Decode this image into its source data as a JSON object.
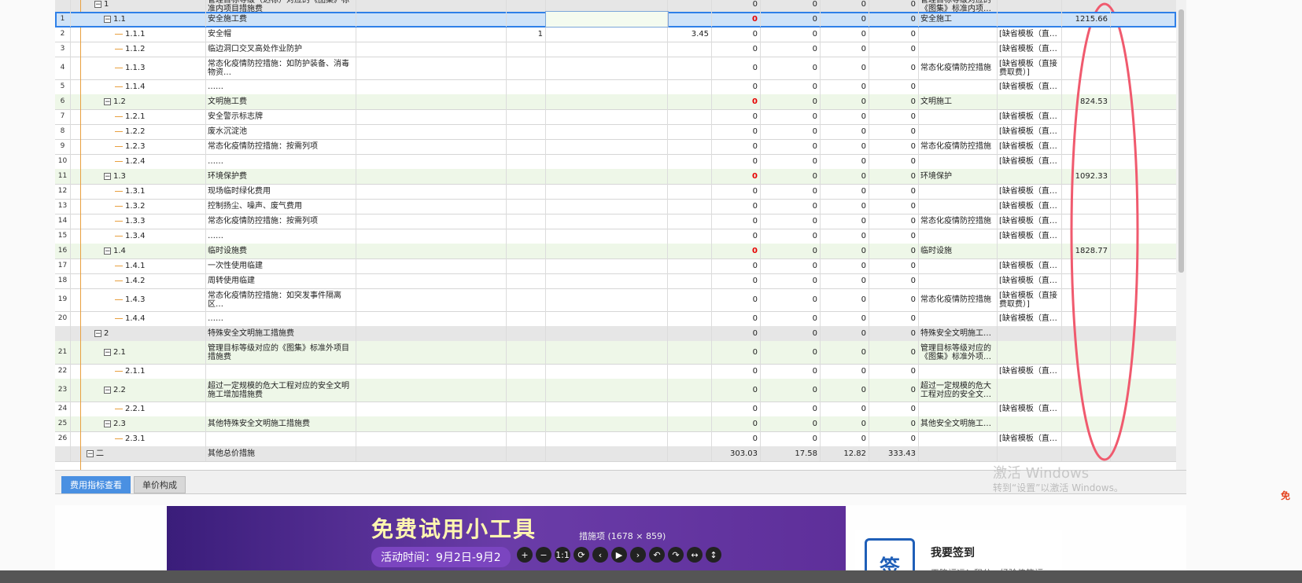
{
  "rows": [
    {
      "num": "",
      "code": "1",
      "depth": 1,
      "toggle": "−",
      "name": "管理目标等级（达标）对应的《图集》标准内项目措施费",
      "d1": "",
      "d2": "",
      "d4": "",
      "v1": "0",
      "v1red": false,
      "v2": "0",
      "v3": "0",
      "v4": "0",
      "cat": "管理目标等级对应的《图集》标准内项…",
      "tpl": "",
      "amt": "",
      "style": "gray",
      "h": 20
    },
    {
      "num": "1",
      "code": "1.1",
      "depth": 2,
      "toggle": "−",
      "name": "安全施工费",
      "d1": "",
      "d2": "",
      "d4": "",
      "v1": "0",
      "v1red": true,
      "v2": "0",
      "v3": "0",
      "v4": "0",
      "cat": "安全施工",
      "tpl": "",
      "amt": "1215.66",
      "style": "sel",
      "h": 20
    },
    {
      "num": "2",
      "code": "1.1.1",
      "depth": 3,
      "toggle": "",
      "name": "安全帽",
      "d1": "",
      "d2": "1",
      "d4": "3.45",
      "v1": "0",
      "v1red": false,
      "v2": "0",
      "v3": "0",
      "v4": "0",
      "cat": "",
      "tpl": "[缺省模板（直…",
      "amt": "",
      "style": "",
      "h": 20
    },
    {
      "num": "3",
      "code": "1.1.2",
      "depth": 3,
      "toggle": "",
      "name": "临边洞口交叉高处作业防护",
      "d1": "",
      "d2": "",
      "d4": "",
      "v1": "0",
      "v1red": false,
      "v2": "0",
      "v3": "0",
      "v4": "0",
      "cat": "",
      "tpl": "[缺省模板（直…",
      "amt": "",
      "style": "",
      "h": 20
    },
    {
      "num": "4",
      "code": "1.1.3",
      "depth": 3,
      "toggle": "",
      "name": "常态化疫情防控措施：如防护装备、消毒物资…",
      "d1": "",
      "d2": "",
      "d4": "",
      "v1": "0",
      "v1red": false,
      "v2": "0",
      "v3": "0",
      "v4": "0",
      "cat": "常态化疫情防控措施",
      "tpl": "[缺省模板（直接费取费）]",
      "amt": "",
      "style": "",
      "h": 30
    },
    {
      "num": "5",
      "code": "1.1.4",
      "depth": 3,
      "toggle": "",
      "name": "……",
      "d1": "",
      "d2": "",
      "d4": "",
      "v1": "0",
      "v1red": false,
      "v2": "0",
      "v3": "0",
      "v4": "0",
      "cat": "",
      "tpl": "[缺省模板（直…",
      "amt": "",
      "style": "",
      "h": 20
    },
    {
      "num": "6",
      "code": "1.2",
      "depth": 2,
      "toggle": "−",
      "name": "文明施工费",
      "d1": "",
      "d2": "",
      "d4": "",
      "v1": "0",
      "v1red": true,
      "v2": "0",
      "v3": "0",
      "v4": "0",
      "cat": "文明施工",
      "tpl": "",
      "amt": "824.53",
      "style": "g",
      "h": 20
    },
    {
      "num": "7",
      "code": "1.2.1",
      "depth": 3,
      "toggle": "",
      "name": "安全警示标志牌",
      "d1": "",
      "d2": "",
      "d4": "",
      "v1": "0",
      "v1red": false,
      "v2": "0",
      "v3": "0",
      "v4": "0",
      "cat": "",
      "tpl": "[缺省模板（直…",
      "amt": "",
      "style": "",
      "h": 20
    },
    {
      "num": "8",
      "code": "1.2.2",
      "depth": 3,
      "toggle": "",
      "name": "废水沉淀池",
      "d1": "",
      "d2": "",
      "d4": "",
      "v1": "0",
      "v1red": false,
      "v2": "0",
      "v3": "0",
      "v4": "0",
      "cat": "",
      "tpl": "[缺省模板（直…",
      "amt": "",
      "style": "",
      "h": 20
    },
    {
      "num": "9",
      "code": "1.2.3",
      "depth": 3,
      "toggle": "",
      "name": "常态化疫情防控措施：按需列项",
      "d1": "",
      "d2": "",
      "d4": "",
      "v1": "0",
      "v1red": false,
      "v2": "0",
      "v3": "0",
      "v4": "0",
      "cat": "常态化疫情防控措施",
      "tpl": "[缺省模板（直…",
      "amt": "",
      "style": "",
      "h": 20
    },
    {
      "num": "10",
      "code": "1.2.4",
      "depth": 3,
      "toggle": "",
      "name": "……",
      "d1": "",
      "d2": "",
      "d4": "",
      "v1": "0",
      "v1red": false,
      "v2": "0",
      "v3": "0",
      "v4": "0",
      "cat": "",
      "tpl": "[缺省模板（直…",
      "amt": "",
      "style": "",
      "h": 20
    },
    {
      "num": "11",
      "code": "1.3",
      "depth": 2,
      "toggle": "−",
      "name": "环境保护费",
      "d1": "",
      "d2": "",
      "d4": "",
      "v1": "0",
      "v1red": true,
      "v2": "0",
      "v3": "0",
      "v4": "0",
      "cat": "环境保护",
      "tpl": "",
      "amt": "1092.33",
      "style": "g",
      "h": 20
    },
    {
      "num": "12",
      "code": "1.3.1",
      "depth": 3,
      "toggle": "",
      "name": "现场临时绿化费用",
      "d1": "",
      "d2": "",
      "d4": "",
      "v1": "0",
      "v1red": false,
      "v2": "0",
      "v3": "0",
      "v4": "0",
      "cat": "",
      "tpl": "[缺省模板（直…",
      "amt": "",
      "style": "",
      "h": 20
    },
    {
      "num": "13",
      "code": "1.3.2",
      "depth": 3,
      "toggle": "",
      "name": "控制扬尘、噪声、废气费用",
      "d1": "",
      "d2": "",
      "d4": "",
      "v1": "0",
      "v1red": false,
      "v2": "0",
      "v3": "0",
      "v4": "0",
      "cat": "",
      "tpl": "[缺省模板（直…",
      "amt": "",
      "style": "",
      "h": 20
    },
    {
      "num": "14",
      "code": "1.3.3",
      "depth": 3,
      "toggle": "",
      "name": "常态化疫情防控措施：按需列项",
      "d1": "",
      "d2": "",
      "d4": "",
      "v1": "0",
      "v1red": false,
      "v2": "0",
      "v3": "0",
      "v4": "0",
      "cat": "常态化疫情防控措施",
      "tpl": "[缺省模板（直…",
      "amt": "",
      "style": "",
      "h": 20
    },
    {
      "num": "15",
      "code": "1.3.4",
      "depth": 3,
      "toggle": "",
      "name": "……",
      "d1": "",
      "d2": "",
      "d4": "",
      "v1": "0",
      "v1red": false,
      "v2": "0",
      "v3": "0",
      "v4": "0",
      "cat": "",
      "tpl": "[缺省模板（直…",
      "amt": "",
      "style": "",
      "h": 20
    },
    {
      "num": "16",
      "code": "1.4",
      "depth": 2,
      "toggle": "−",
      "name": "临时设施费",
      "d1": "",
      "d2": "",
      "d4": "",
      "v1": "0",
      "v1red": true,
      "v2": "0",
      "v3": "0",
      "v4": "0",
      "cat": "临时设施",
      "tpl": "",
      "amt": "1828.77",
      "style": "g",
      "h": 20
    },
    {
      "num": "17",
      "code": "1.4.1",
      "depth": 3,
      "toggle": "",
      "name": "一次性使用临建",
      "d1": "",
      "d2": "",
      "d4": "",
      "v1": "0",
      "v1red": false,
      "v2": "0",
      "v3": "0",
      "v4": "0",
      "cat": "",
      "tpl": "[缺省模板（直…",
      "amt": "",
      "style": "",
      "h": 20
    },
    {
      "num": "18",
      "code": "1.4.2",
      "depth": 3,
      "toggle": "",
      "name": "周转使用临建",
      "d1": "",
      "d2": "",
      "d4": "",
      "v1": "0",
      "v1red": false,
      "v2": "0",
      "v3": "0",
      "v4": "0",
      "cat": "",
      "tpl": "[缺省模板（直…",
      "amt": "",
      "style": "",
      "h": 20
    },
    {
      "num": "19",
      "code": "1.4.3",
      "depth": 3,
      "toggle": "",
      "name": "常态化疫情防控措施：如突发事件隔离区…",
      "d1": "",
      "d2": "",
      "d4": "",
      "v1": "0",
      "v1red": false,
      "v2": "0",
      "v3": "0",
      "v4": "0",
      "cat": "常态化疫情防控措施",
      "tpl": "[缺省模板（直接费取费）]",
      "amt": "",
      "style": "",
      "h": 30
    },
    {
      "num": "20",
      "code": "1.4.4",
      "depth": 3,
      "toggle": "",
      "name": "……",
      "d1": "",
      "d2": "",
      "d4": "",
      "v1": "0",
      "v1red": false,
      "v2": "0",
      "v3": "0",
      "v4": "0",
      "cat": "",
      "tpl": "[缺省模板（直…",
      "amt": "",
      "style": "",
      "h": 20
    },
    {
      "num": "",
      "code": "2",
      "depth": 1,
      "toggle": "−",
      "name": "特殊安全文明施工措施费",
      "d1": "",
      "d2": "",
      "d4": "",
      "v1": "0",
      "v1red": false,
      "v2": "0",
      "v3": "0",
      "v4": "0",
      "cat": "特殊安全文明施工…",
      "tpl": "",
      "amt": "",
      "style": "gray",
      "h": 20
    },
    {
      "num": "21",
      "code": "2.1",
      "depth": 2,
      "toggle": "−",
      "name": "管理目标等级对应的《图集》标准外项目措施费",
      "d1": "",
      "d2": "",
      "d4": "",
      "v1": "0",
      "v1red": false,
      "v2": "0",
      "v3": "0",
      "v4": "0",
      "cat": "管理目标等级对应的《图集》标准外项…",
      "tpl": "",
      "amt": "",
      "style": "g",
      "h": 30
    },
    {
      "num": "22",
      "code": "2.1.1",
      "depth": 3,
      "toggle": "",
      "name": "",
      "d1": "",
      "d2": "",
      "d4": "",
      "v1": "0",
      "v1red": false,
      "v2": "0",
      "v3": "0",
      "v4": "0",
      "cat": "",
      "tpl": "[缺省模板（直…",
      "amt": "",
      "style": "",
      "h": 20
    },
    {
      "num": "23",
      "code": "2.2",
      "depth": 2,
      "toggle": "−",
      "name": "超过一定规模的危大工程对应的安全文明施工增加措施费",
      "d1": "",
      "d2": "",
      "d4": "",
      "v1": "0",
      "v1red": false,
      "v2": "0",
      "v3": "0",
      "v4": "0",
      "cat": "超过一定规模的危大工程对应的安全文…",
      "tpl": "",
      "amt": "",
      "style": "g",
      "h": 30
    },
    {
      "num": "24",
      "code": "2.2.1",
      "depth": 3,
      "toggle": "",
      "name": "",
      "d1": "",
      "d2": "",
      "d4": "",
      "v1": "0",
      "v1red": false,
      "v2": "0",
      "v3": "0",
      "v4": "0",
      "cat": "",
      "tpl": "[缺省模板（直…",
      "amt": "",
      "style": "",
      "h": 20
    },
    {
      "num": "25",
      "code": "2.3",
      "depth": 2,
      "toggle": "−",
      "name": "其他特殊安全文明施工措施费",
      "d1": "",
      "d2": "",
      "d4": "",
      "v1": "0",
      "v1red": false,
      "v2": "0",
      "v3": "0",
      "v4": "0",
      "cat": "其他安全文明施工…",
      "tpl": "",
      "amt": "",
      "style": "g",
      "h": 20
    },
    {
      "num": "26",
      "code": "2.3.1",
      "depth": 3,
      "toggle": "",
      "name": "",
      "d1": "",
      "d2": "",
      "d4": "",
      "v1": "0",
      "v1red": false,
      "v2": "0",
      "v3": "0",
      "v4": "0",
      "cat": "",
      "tpl": "[缺省模板（直…",
      "amt": "",
      "style": "",
      "h": 20
    },
    {
      "num": "",
      "code": "二",
      "depth": 0,
      "toggle": "−",
      "name": "其他总价措施",
      "d1": "",
      "d2": "",
      "d4": "",
      "v1": "303.03",
      "v1red": false,
      "v2": "17.58",
      "v3": "12.82",
      "v4": "333.43",
      "cat": "",
      "tpl": "",
      "amt": "",
      "style": "gray",
      "h": 20
    }
  ],
  "tabs": {
    "tab1": "费用指标查看",
    "tab2": "单价构成"
  },
  "banner": {
    "title": "免费试用小工具",
    "date": "活动时间：9月2日-9月2"
  },
  "viewer": {
    "caption": "措施项 (1678 × 859)",
    "btn_zoom_in": "+",
    "btn_zoom_out": "−",
    "btn_reset": "1:1",
    "btn_rotate": "⟳",
    "btn_prev": "‹",
    "btn_play": "▶",
    "btn_next": "›",
    "btn_undo": "↶",
    "btn_redo": "↷",
    "btn_fit_w": "↔",
    "btn_fit_h": "↕"
  },
  "sign": {
    "icon_char": "签",
    "title": "我要签到",
    "subtitle": "天降福运！积分，经验值等福"
  },
  "watermark": {
    "line1": "激活 Windows",
    "line2": "转到“设置”以激活 Windows。"
  },
  "side_badge": "免",
  "colors": {
    "selection_outline": "#2f80e8",
    "annotation_circle": "#f05a6e",
    "active_tab": "#4a90e2",
    "red_value": "#e60000"
  }
}
